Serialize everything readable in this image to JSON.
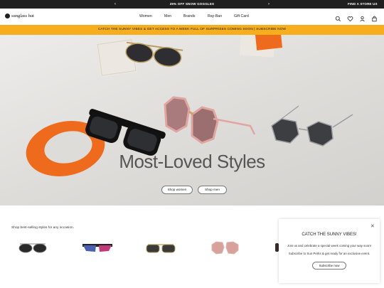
{
  "topbar": {
    "promo": "25% OFF SNOW GOGGLES",
    "find_store": "FIND A STORE",
    "country": "US",
    "prev_icon": "chevron-left-icon",
    "next_icon": "chevron-right-icon"
  },
  "header": {
    "logo": "sunglass hut",
    "nav": [
      "Women",
      "Men",
      "Brands",
      "Ray-Ban",
      "Gift Card"
    ],
    "icons": [
      "search-icon",
      "heart-icon",
      "user-icon",
      "bag-icon"
    ]
  },
  "banner": {
    "text": "CATCH THE SUNNY VIBES & GET ACCESS TO A WEEK FULL OF SURPRISES COMING SOON | SUBSCRIBE NOW",
    "color": "#f6ae1e"
  },
  "hero": {
    "title": "Most-Loved Styles",
    "shop_women": "Shop women",
    "shop_men": "Shop men",
    "accent": "#ee6b1e"
  },
  "bestsellers": {
    "label": "Shop best-selling styles for any occasion."
  },
  "popup": {
    "title": "CATCH THE SUNNY VIBES!",
    "line1": "Join us and celebrate a special week coming your way soon!",
    "line2": "Subscribe to Sun Perks & get ready for an exclusive event.",
    "button": "Subscribe now",
    "close_icon": "close-icon"
  }
}
